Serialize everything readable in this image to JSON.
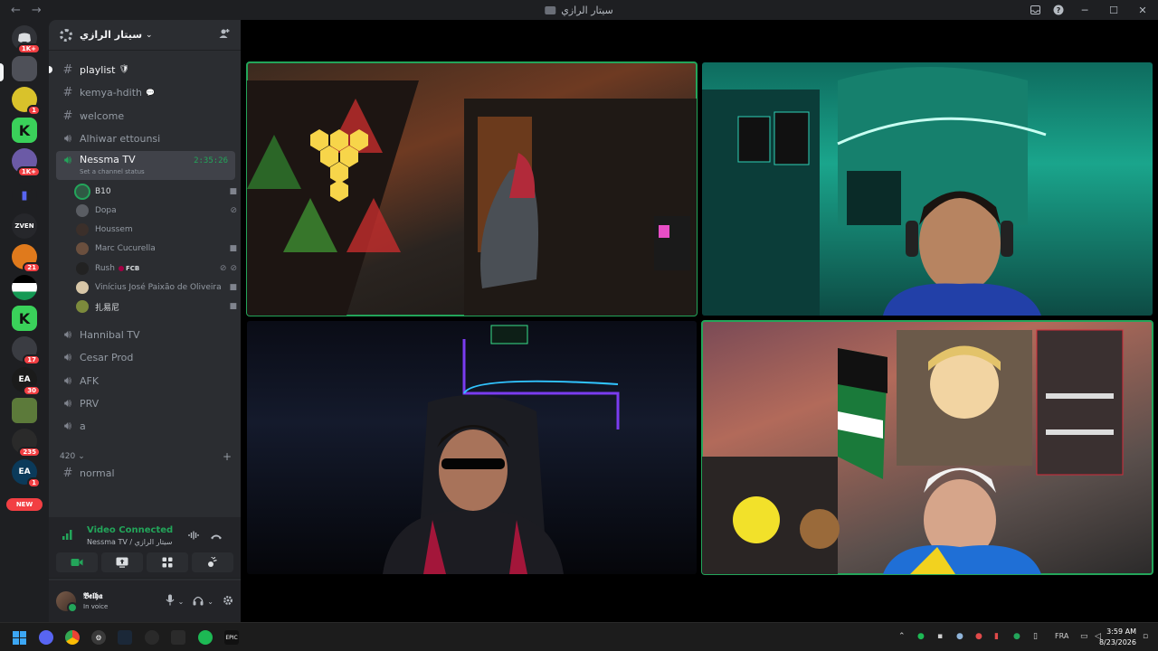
{
  "window": {
    "title": "سيتار الرازي",
    "back": "←",
    "forward": "→"
  },
  "rail": {
    "badges": [
      "1K+",
      "1",
      "1K+",
      "21",
      "17",
      "30",
      "235",
      "1"
    ],
    "new_label": "NEW"
  },
  "server": {
    "name": "سيتار الرازي"
  },
  "channels": [
    {
      "name": "playlist",
      "type": "text",
      "emoji": "🛡"
    },
    {
      "name": "kemya-hdith",
      "type": "text",
      "emoji": "💬"
    },
    {
      "name": "welcome",
      "type": "text"
    },
    {
      "name": "Alhiwar ettounsi",
      "type": "voice"
    },
    {
      "name": "Nessma TV",
      "type": "voice",
      "timer": "2:35:26",
      "status": "Set a channel status"
    }
  ],
  "voice_users": [
    {
      "name": "B10",
      "speaking": true
    },
    {
      "name": "Dopa"
    },
    {
      "name": "Houssem"
    },
    {
      "name": "Marc Cucurella"
    },
    {
      "name": "Rush",
      "tag": "FCB"
    },
    {
      "name": "Vinícius José Paixão de Oliveira"
    },
    {
      "name": "扎易尼"
    }
  ],
  "more_channels": [
    {
      "name": "Hannibal TV"
    },
    {
      "name": "Cesar Prod"
    },
    {
      "name": "AFK"
    },
    {
      "name": "PRV"
    },
    {
      "name": "a"
    }
  ],
  "category": {
    "name": "420",
    "channel": "normal"
  },
  "voice_panel": {
    "title": "Video Connected",
    "subtitle": "Nessma TV / سيتار الرازي"
  },
  "user": {
    "name": "𝕭𝖊𝖑𝖍𝖆",
    "status": "In voice"
  },
  "taskbar": {
    "lang": "FRA",
    "time": "3:59 AM",
    "date": "8/23/2026"
  },
  "colors": {
    "accent_green": "#23a55a",
    "background": "#1e1f22",
    "sidebar": "#2b2d31",
    "danger": "#f23f43"
  }
}
